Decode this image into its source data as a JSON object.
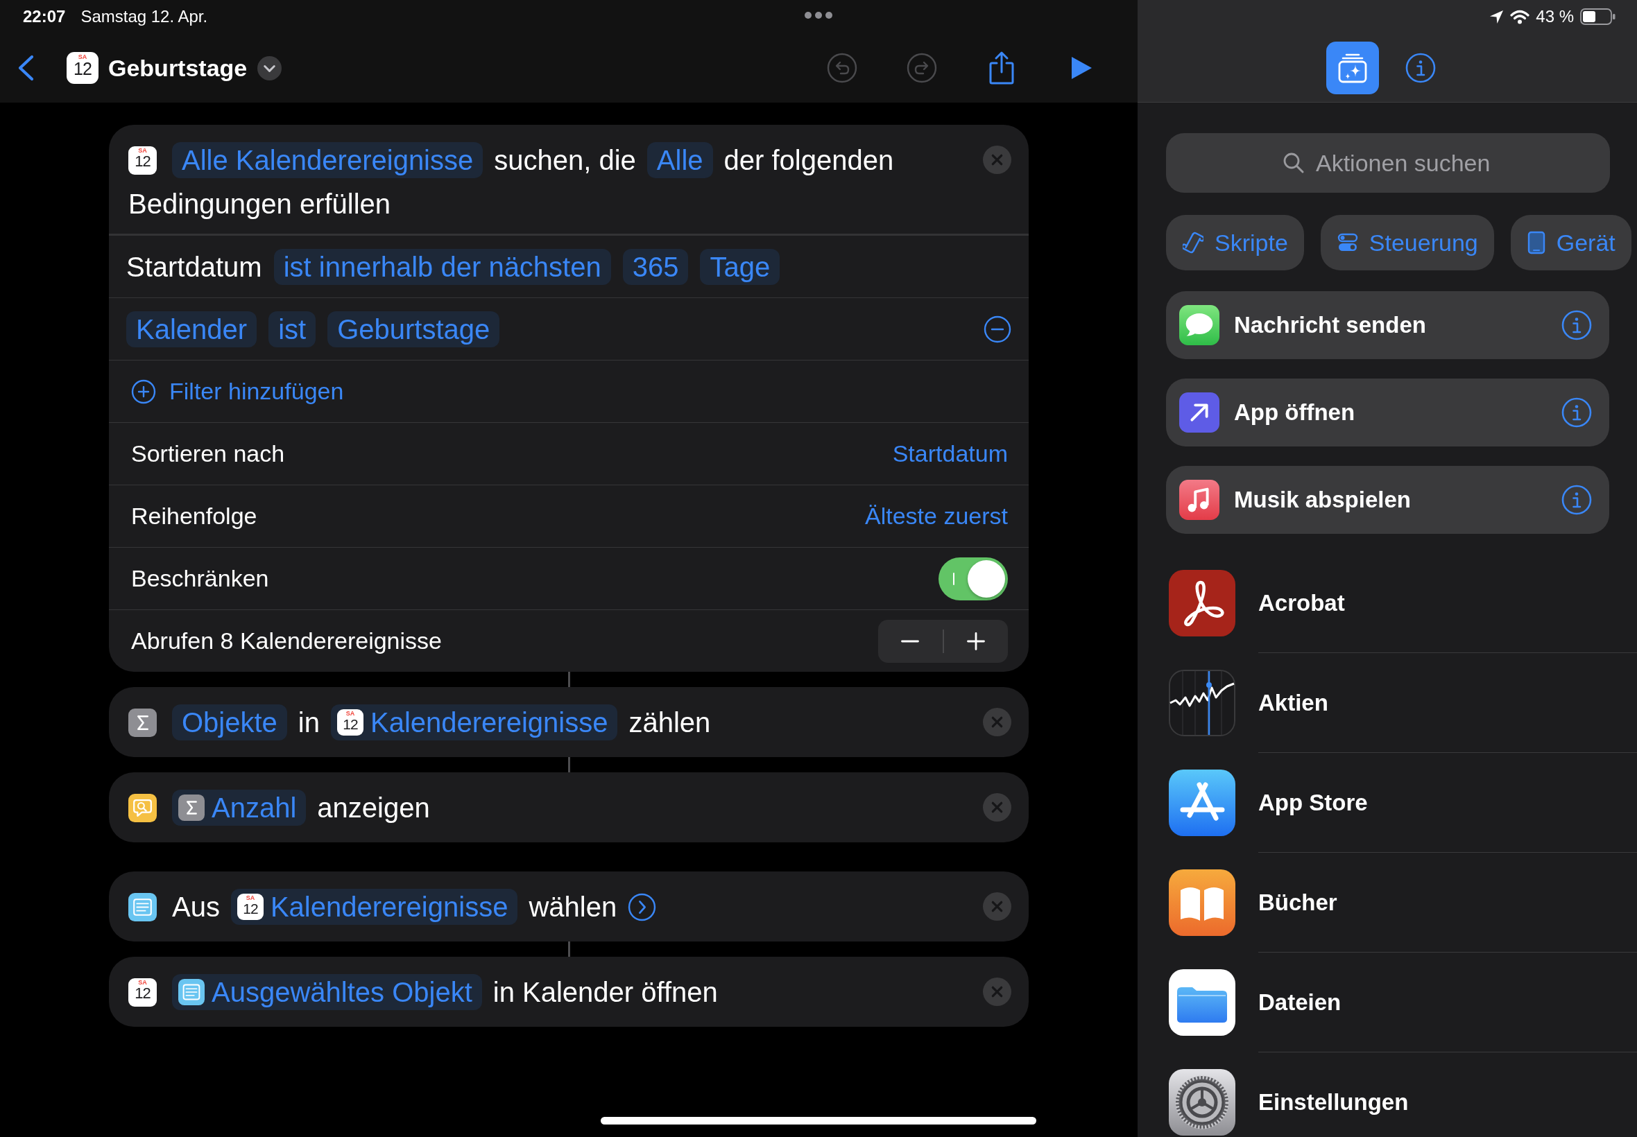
{
  "status_bar": {
    "time": "22:07",
    "date": "Samstag 12. Apr.",
    "battery": "43 %"
  },
  "nav_bar": {
    "title": "Geburtstage",
    "icon": {
      "kind": "calendar",
      "weekday": "SA",
      "day": "12"
    },
    "buttons": [
      {
        "kind": "undo",
        "disabled": true
      },
      {
        "kind": "redo",
        "disabled": true
      },
      {
        "kind": "share",
        "disabled": false
      },
      {
        "kind": "run",
        "disabled": false
      }
    ]
  },
  "editor": {
    "actions": [
      {
        "icon": {
          "kind": "calendar",
          "weekday": "SA",
          "day": "12"
        },
        "parts": [
          {
            "kind": "token",
            "text": "Alle Kalenderereignisse"
          },
          {
            "kind": "text",
            "text": "suchen, die"
          },
          {
            "kind": "token",
            "text": "Alle"
          },
          {
            "kind": "text",
            "text": "der folgenden"
          },
          {
            "kind": "text",
            "text": "Bedingungen erfüllen"
          }
        ],
        "filters": [
          {
            "removable": false,
            "parts": [
              {
                "kind": "text",
                "text": "Startdatum"
              },
              {
                "kind": "token",
                "text": "ist innerhalb der nächsten"
              },
              {
                "kind": "token",
                "text": "365"
              },
              {
                "kind": "token",
                "text": "Tage"
              }
            ]
          },
          {
            "removable": true,
            "parts": [
              {
                "kind": "token",
                "text": "Kalender"
              },
              {
                "kind": "token",
                "text": "ist"
              },
              {
                "kind": "token",
                "text": "Geburtstage"
              }
            ]
          }
        ],
        "add_filter": "Filter hinzufügen",
        "options": [
          {
            "kind": "value",
            "label": "Sortieren nach",
            "value": "Startdatum"
          },
          {
            "kind": "value",
            "label": "Reihenfolge",
            "value": "Älteste zuerst"
          },
          {
            "kind": "switch",
            "label": "Beschränken",
            "on": true
          },
          {
            "kind": "stepper",
            "label": "Abrufen 8 Kalenderereignisse"
          }
        ],
        "linked_to_next": true
      },
      {
        "icon": {
          "kind": "sigma"
        },
        "parts": [
          {
            "kind": "token",
            "text": "Objekte"
          },
          {
            "kind": "text",
            "text": "in"
          },
          {
            "kind": "token",
            "text": "Kalenderereignisse",
            "icon": {
              "kind": "calendar",
              "weekday": "SA",
              "day": "12"
            }
          },
          {
            "kind": "text",
            "text": "zählen"
          }
        ],
        "linked_to_next": true
      },
      {
        "icon": {
          "kind": "quicklook"
        },
        "parts": [
          {
            "kind": "token",
            "text": "Anzahl",
            "icon": {
              "kind": "sigma"
            }
          },
          {
            "kind": "text",
            "text": "anzeigen"
          }
        ],
        "linked_to_next": false
      },
      {
        "icon": {
          "kind": "list"
        },
        "parts": [
          {
            "kind": "text",
            "text": "Aus"
          },
          {
            "kind": "token",
            "text": "Kalenderereignisse",
            "icon": {
              "kind": "calendar",
              "weekday": "SA",
              "day": "12"
            }
          },
          {
            "kind": "text",
            "text": "wählen"
          },
          {
            "kind": "expand"
          }
        ],
        "linked_to_next": true
      },
      {
        "icon": {
          "kind": "calendar",
          "weekday": "SA",
          "day": "12"
        },
        "parts": [
          {
            "kind": "token",
            "text": "Ausgewähltes Objekt",
            "icon": {
              "kind": "list"
            }
          },
          {
            "kind": "text",
            "text": "in Kalender öffnen"
          }
        ],
        "linked_to_next": false
      }
    ]
  },
  "library": {
    "tabs": [
      {
        "kind": "actions",
        "selected": true
      },
      {
        "kind": "info",
        "selected": false
      }
    ],
    "search": {
      "placeholder": "Aktionen suchen"
    },
    "categories": [
      {
        "kind": "scripting",
        "label": "Skripte"
      },
      {
        "kind": "controls",
        "label": "Steuerung"
      },
      {
        "kind": "device",
        "label": "Gerät"
      }
    ],
    "suggestions": [
      {
        "kind": "messages",
        "label": "Nachricht senden"
      },
      {
        "kind": "open_app",
        "label": "App öffnen"
      },
      {
        "kind": "music",
        "label": "Musik abspielen"
      }
    ],
    "apps": [
      {
        "kind": "acrobat",
        "label": "Acrobat"
      },
      {
        "kind": "stocks",
        "label": "Aktien"
      },
      {
        "kind": "app_store",
        "label": "App Store"
      },
      {
        "kind": "books",
        "label": "Bücher"
      },
      {
        "kind": "files",
        "label": "Dateien"
      },
      {
        "kind": "settings",
        "label": "Einstellungen"
      }
    ]
  }
}
